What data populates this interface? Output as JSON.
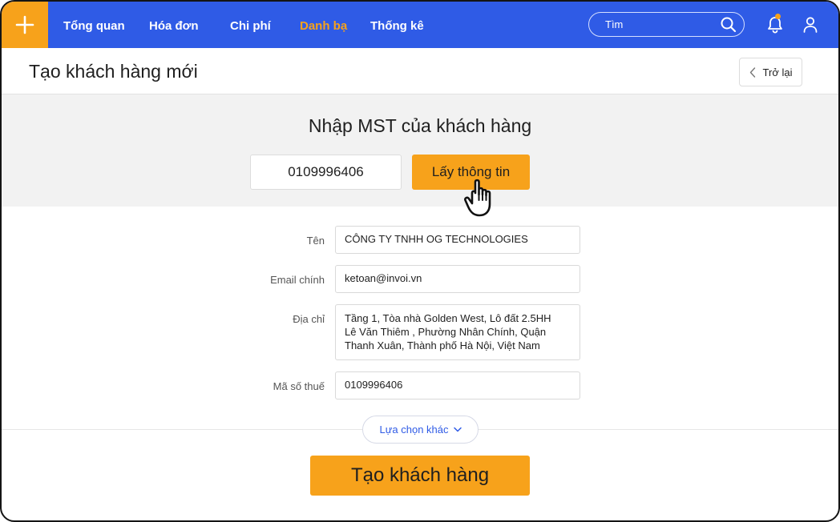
{
  "nav": {
    "items": [
      {
        "label": "Tổng quan",
        "active": false
      },
      {
        "label": "Hóa đơn",
        "active": false
      },
      {
        "label": "Chi phí",
        "active": false
      },
      {
        "label": "Danh bạ",
        "active": true
      },
      {
        "label": "Thống kê",
        "active": false
      }
    ],
    "search_placeholder": "Tìm",
    "has_notification": true
  },
  "header": {
    "title": "Tạo khách hàng mới",
    "back_label": "Trở lại"
  },
  "mst": {
    "title": "Nhập MST của khách hàng",
    "value": "0109996406",
    "fetch_label": "Lấy thông tin"
  },
  "form": {
    "name_label": "Tên",
    "name_value": "CÔNG TY TNHH OG TECHNOLOGIES",
    "email_label": "Email chính",
    "email_value": "ketoan@invoi.vn",
    "address_label": "Địa chỉ",
    "address_lines": [
      "Tầng 1, Tòa nhà Golden West, Lô đất 2.5HH",
      "Lê Văn Thiêm , Phường Nhân Chính, Quận",
      "Thanh Xuân, Thành phố Hà Nội, Việt Nam"
    ],
    "tax_label": "Mã số thuế",
    "tax_value": "0109996406"
  },
  "more_options_label": "Lựa chọn khác",
  "create_label": "Tạo khách hàng",
  "colors": {
    "primary": "#2f5be6",
    "accent": "#f7a21b"
  }
}
